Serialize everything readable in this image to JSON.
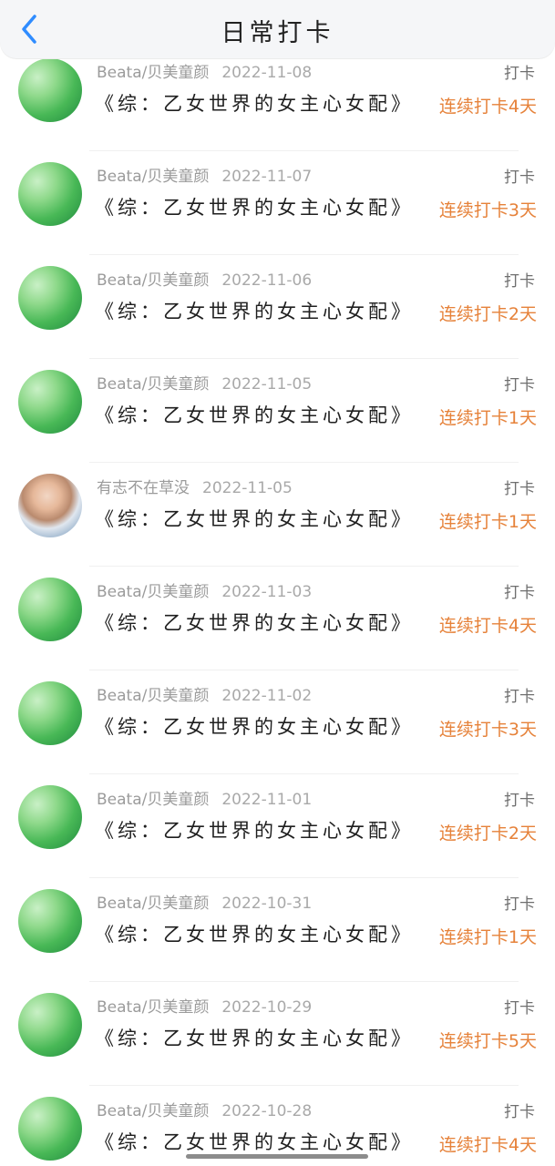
{
  "header": {
    "title": "日常打卡",
    "back_icon": "chevron-left-icon",
    "accent_color": "#2f8cff"
  },
  "records": [
    {
      "user": "Beata/贝美童颜",
      "date": "2022-11-08",
      "action": "打卡",
      "book": "《综：乙女世界的女主心女配》",
      "streak": "连续打卡4天",
      "avatar": "green-avatar"
    },
    {
      "user": "Beata/贝美童颜",
      "date": "2022-11-07",
      "action": "打卡",
      "book": "《综：乙女世界的女主心女配》",
      "streak": "连续打卡3天",
      "avatar": "green-avatar"
    },
    {
      "user": "Beata/贝美童颜",
      "date": "2022-11-06",
      "action": "打卡",
      "book": "《综：乙女世界的女主心女配》",
      "streak": "连续打卡2天",
      "avatar": "green-avatar"
    },
    {
      "user": "Beata/贝美童颜",
      "date": "2022-11-05",
      "action": "打卡",
      "book": "《综：乙女世界的女主心女配》",
      "streak": "连续打卡1天",
      "avatar": "green-avatar"
    },
    {
      "user": "有志不在草没",
      "date": "2022-11-05",
      "action": "打卡",
      "book": "《综：乙女世界的女主心女配》",
      "streak": "连续打卡1天",
      "avatar": "photo-avatar"
    },
    {
      "user": "Beata/贝美童颜",
      "date": "2022-11-03",
      "action": "打卡",
      "book": "《综：乙女世界的女主心女配》",
      "streak": "连续打卡4天",
      "avatar": "green-avatar"
    },
    {
      "user": "Beata/贝美童颜",
      "date": "2022-11-02",
      "action": "打卡",
      "book": "《综：乙女世界的女主心女配》",
      "streak": "连续打卡3天",
      "avatar": "green-avatar"
    },
    {
      "user": "Beata/贝美童颜",
      "date": "2022-11-01",
      "action": "打卡",
      "book": "《综：乙女世界的女主心女配》",
      "streak": "连续打卡2天",
      "avatar": "green-avatar"
    },
    {
      "user": "Beata/贝美童颜",
      "date": "2022-10-31",
      "action": "打卡",
      "book": "《综：乙女世界的女主心女配》",
      "streak": "连续打卡1天",
      "avatar": "green-avatar"
    },
    {
      "user": "Beata/贝美童颜",
      "date": "2022-10-29",
      "action": "打卡",
      "book": "《综：乙女世界的女主心女配》",
      "streak": "连续打卡5天",
      "avatar": "green-avatar"
    },
    {
      "user": "Beata/贝美童颜",
      "date": "2022-10-28",
      "action": "打卡",
      "book": "《综：乙女世界的女主心女配》",
      "streak": "连续打卡4天",
      "avatar": "green-avatar"
    }
  ],
  "colors": {
    "streak": "#e6823a",
    "meta": "#9b9b9b",
    "header_bg": "#f5f6f8"
  }
}
